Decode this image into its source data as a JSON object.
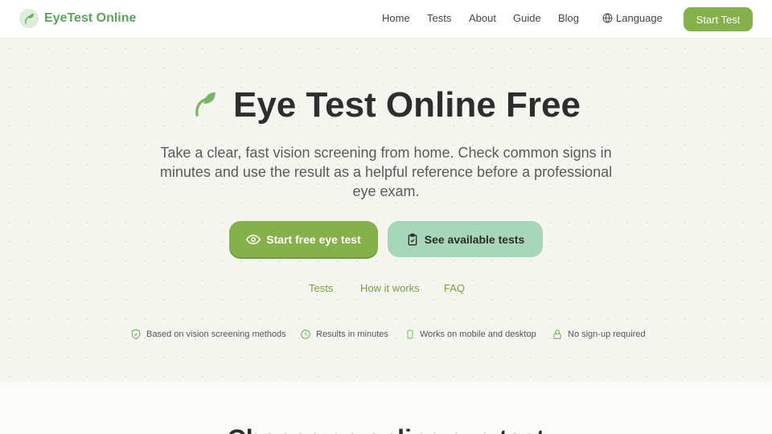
{
  "brand": {
    "name": "EyeTest Online",
    "logo_icon": "leaf-icon",
    "color": "#5ea35a"
  },
  "nav": {
    "items": [
      {
        "label": "Home"
      },
      {
        "label": "Tests"
      },
      {
        "label": "About"
      },
      {
        "label": "Guide"
      },
      {
        "label": "Blog"
      }
    ],
    "language": {
      "label": "Language",
      "icon": "globe-icon"
    },
    "start_label": "Start Test"
  },
  "hero": {
    "title": "Eye Test Online Free",
    "title_icon": "leaf-icon",
    "subtitle": "Take a clear, fast vision screening from home. Check common signs in minutes and use the result as a helpful reference before a professional eye exam.",
    "primary_cta": {
      "label": "Start free eye test",
      "icon": "eye-icon"
    },
    "secondary_cta": {
      "label": "See available tests",
      "icon": "clipboard-check-icon"
    },
    "links": [
      {
        "label": "Tests"
      },
      {
        "label": "How it works"
      },
      {
        "label": "FAQ"
      }
    ],
    "features": [
      {
        "label": "Based on vision screening methods",
        "icon": "shield-check-icon"
      },
      {
        "label": "Results in minutes",
        "icon": "clock-icon"
      },
      {
        "label": "Works on mobile and desktop",
        "icon": "smartphone-icon"
      },
      {
        "label": "No sign-up required",
        "icon": "lock-icon"
      }
    ]
  },
  "next_section": {
    "heading": "Choose an online eye test"
  },
  "colors": {
    "accent": "#86b04a",
    "secondary": "#a7d6bb",
    "link": "#7a9e3e"
  }
}
